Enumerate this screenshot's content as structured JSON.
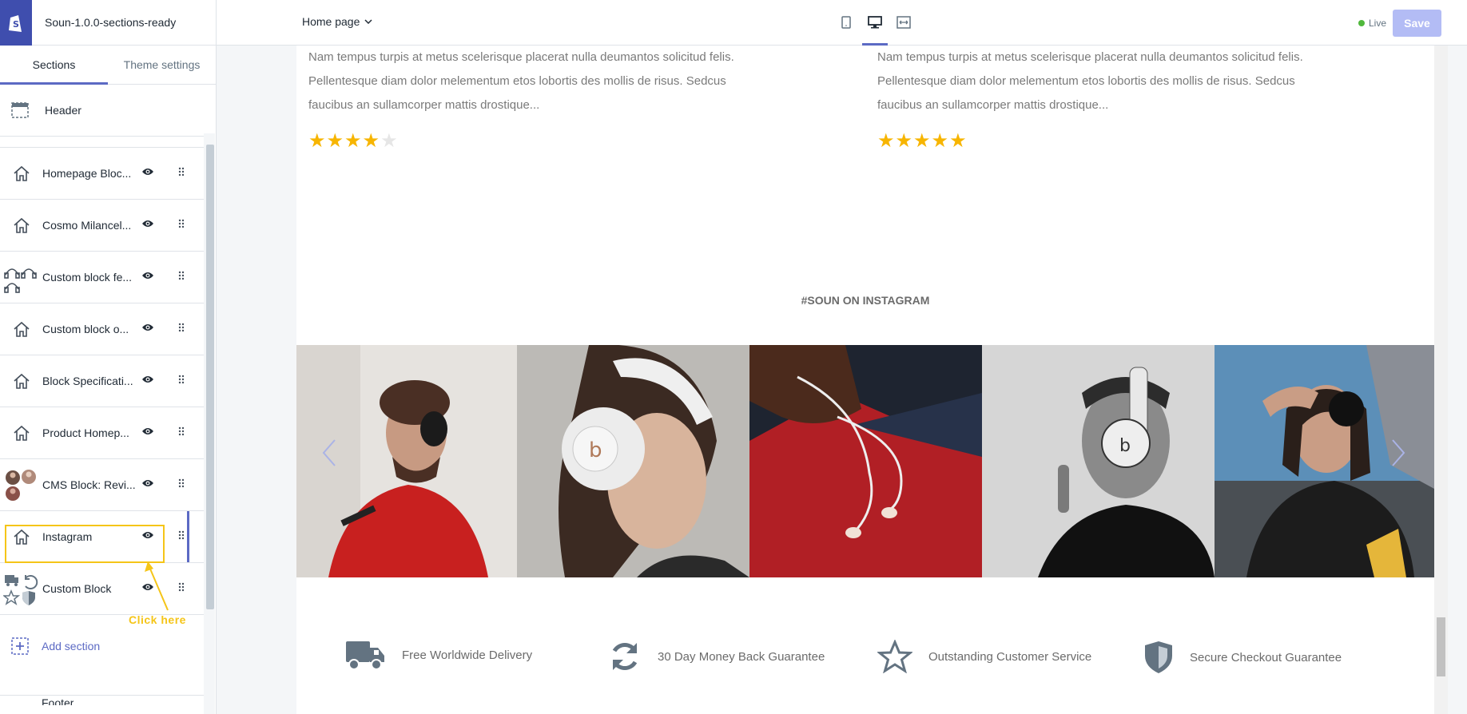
{
  "topbar": {
    "theme_name": "Soun-1.0.0-sections-ready",
    "page_selector": "Home page",
    "live_label": "Live",
    "save_label": "Save"
  },
  "sidebar": {
    "tabs": [
      {
        "label": "Sections",
        "active": true
      },
      {
        "label": "Theme settings",
        "active": false
      }
    ],
    "header_item": "Header",
    "items": [
      {
        "label": "Homepage Bloc...",
        "icon": "home-icon"
      },
      {
        "label": "Cosmo Milancel...",
        "icon": "home-icon"
      },
      {
        "label": "Custom block fe...",
        "icon": "headphones-icon"
      },
      {
        "label": "Custom block o...",
        "icon": "home-icon"
      },
      {
        "label": "Block Specificati...",
        "icon": "home-icon"
      },
      {
        "label": "Product Homep...",
        "icon": "home-icon"
      },
      {
        "label": "CMS Block: Revi...",
        "icon": "avatars-icon"
      },
      {
        "label": "Instagram",
        "icon": "home-icon",
        "selected": true
      },
      {
        "label": "Custom Block",
        "icon": "features-icon"
      }
    ],
    "callout": "Click here",
    "add_section": "Add section",
    "footer_partial": "Footer"
  },
  "preview": {
    "reviews": [
      {
        "lines": [
          "Nam tempus turpis at metus scelerisque placerat nulla deumantos solicitud felis.",
          "Pellentesque diam dolor melementum etos lobortis des mollis de risus. Sedcus",
          "faucibus an sullamcorper mattis drostique..."
        ],
        "rating": 4
      },
      {
        "lines": [
          "Nam tempus turpis at metus scelerisque placerat nulla deumantos solicitud felis.",
          "Pellentesque diam dolor melementum etos lobortis des mollis de risus. Sedcus",
          "faucibus an sullamcorper mattis drostique..."
        ],
        "rating": 5
      }
    ],
    "instagram_title": "#SOUN ON INSTAGRAM",
    "features": [
      {
        "label": "Free Worldwide Delivery",
        "icon": "truck-icon"
      },
      {
        "label": "30 Day Money Back Guarantee",
        "icon": "refresh-icon"
      },
      {
        "label": "Outstanding Customer Service",
        "icon": "star-outline-icon"
      },
      {
        "label": "Secure Checkout Guarantee",
        "icon": "shield-icon"
      }
    ]
  },
  "colors": {
    "accent": "#5c6ac4",
    "brand": "#3f4eae",
    "star": "#f7b500",
    "callout": "#f5c518"
  }
}
